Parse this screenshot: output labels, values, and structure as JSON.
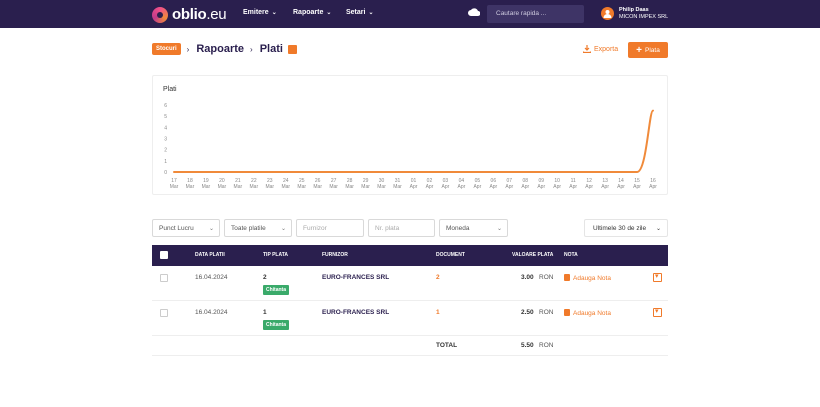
{
  "header": {
    "logo_text": "oblio",
    "logo_suffix": ".eu",
    "nav": [
      {
        "label": "Emitere"
      },
      {
        "label": "Rapoarte"
      },
      {
        "label": "Setari"
      }
    ],
    "search_placeholder": "Cautare rapida ...",
    "user_name": "Philip Daas",
    "company": "MICON IMPEX SRL"
  },
  "breadcrumb": {
    "root": "Stocuri",
    "section": "Rapoarte",
    "page": "Plati"
  },
  "actions": {
    "export_label": "Exporta",
    "add_label": "Plata"
  },
  "chart_data": {
    "type": "line",
    "title": "Plati",
    "ylim": [
      0,
      6
    ],
    "yticks": [
      "6",
      "5",
      "4",
      "3",
      "2",
      "1",
      "0"
    ],
    "x_days": [
      "17",
      "18",
      "19",
      "20",
      "21",
      "22",
      "23",
      "24",
      "25",
      "26",
      "27",
      "28",
      "29",
      "30",
      "31",
      "01",
      "02",
      "03",
      "04",
      "05",
      "06",
      "07",
      "08",
      "09",
      "10",
      "11",
      "12",
      "13",
      "14",
      "15",
      "16"
    ],
    "x_months": [
      "Mar",
      "Mar",
      "Mar",
      "Mar",
      "Mar",
      "Mar",
      "Mar",
      "Mar",
      "Mar",
      "Mar",
      "Mar",
      "Mar",
      "Mar",
      "Mar",
      "Mar",
      "Apr",
      "Apr",
      "Apr",
      "Apr",
      "Apr",
      "Apr",
      "Apr",
      "Apr",
      "Apr",
      "Apr",
      "Apr",
      "Apr",
      "Apr",
      "Apr",
      "Apr",
      "Apr"
    ],
    "series": [
      {
        "values": [
          0,
          0,
          0,
          0,
          0,
          0,
          0,
          0,
          0,
          0,
          0,
          0,
          0,
          0,
          0,
          0,
          0,
          0,
          0,
          0,
          0,
          0,
          0,
          0,
          0,
          0,
          0,
          0,
          0,
          0,
          5.5
        ],
        "color": "#f08a3a"
      }
    ],
    "grid": false
  },
  "filters": {
    "punct_lucru": "Punct Lucru",
    "tip_plata": "Toate platile",
    "furnizor_placeholder": "Furnizor",
    "nr_plata_placeholder": "Nr. plata",
    "moneda": "Moneda",
    "period": "Ultimele 30 de zile"
  },
  "table": {
    "columns": [
      "DATA PLATII",
      "TIP PLATA",
      "FURNIZOR",
      "DOCUMENT",
      "VALOARE PLATA",
      "NOTA"
    ],
    "rows": [
      {
        "date": "16.04.2024",
        "tip": "2",
        "tip_badge": "Chitanta",
        "furnizor": "EURO-FRANCES SRL",
        "document": "2",
        "valoare": "3.00",
        "moneda": "RON",
        "nota": "Adauga Nota"
      },
      {
        "date": "16.04.2024",
        "tip": "1",
        "tip_badge": "Chitanta",
        "furnizor": "EURO-FRANCES SRL",
        "document": "1",
        "valoare": "2.50",
        "moneda": "RON",
        "nota": "Adauga Nota"
      }
    ],
    "total_label": "TOTAL",
    "total_value": "5.50",
    "total_currency": "RON"
  },
  "colors": {
    "header_bg": "#2a1f4e",
    "accent": "#f07a2a",
    "badge_green": "#3aaa6a"
  }
}
